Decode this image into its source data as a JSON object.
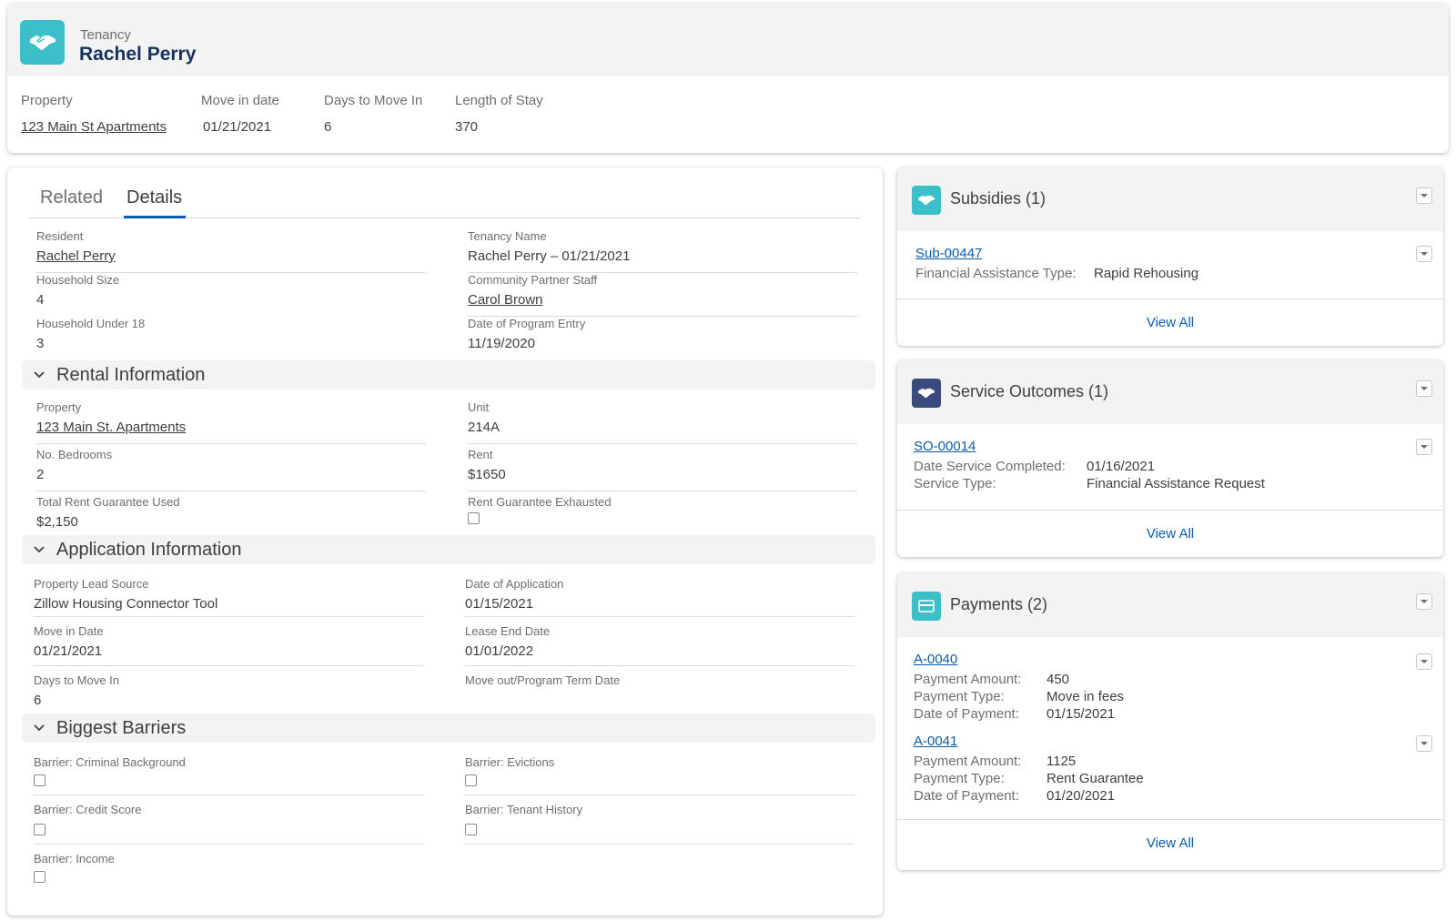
{
  "header": {
    "eyebrow": "Tenancy",
    "title": "Rachel Perry",
    "icon": "handshake-icon",
    "fields": [
      {
        "label": "Property",
        "value": "123 Main St Apartments",
        "is_link": true
      },
      {
        "label": "Move in date",
        "value": "01/21/2021"
      },
      {
        "label": "Days to Move In",
        "value": "6"
      },
      {
        "label": "Length of Stay",
        "value": "370"
      }
    ]
  },
  "tabs": [
    {
      "label": "Related",
      "active": false
    },
    {
      "label": "Details",
      "active": true
    }
  ],
  "details": {
    "resident": {
      "label": "Resident",
      "value": "Rachel Perry"
    },
    "tenancy_name": {
      "label": "Tenancy Name",
      "value": "Rachel Perry – 01/21/2021"
    },
    "household_size": {
      "label": "Household Size",
      "value": "4"
    },
    "partner_staff": {
      "label": "Community Partner Staff",
      "value": "Carol Brown"
    },
    "household_under_18": {
      "label": "Household Under 18",
      "value": "3"
    },
    "program_entry": {
      "label": "Date of Program Entry",
      "value": "11/19/2020"
    }
  },
  "rental": {
    "title": "Rental Information",
    "property": {
      "label": "Property",
      "value": "123 Main St. Apartments"
    },
    "unit": {
      "label": "Unit",
      "value": "214A"
    },
    "bedrooms": {
      "label": "No. Bedrooms",
      "value": "2"
    },
    "rent": {
      "label": "Rent",
      "value": "$1650"
    },
    "guarantee_used": {
      "label": "Total Rent Guarantee Used",
      "value": "$2,150"
    },
    "guarantee_exhausted": {
      "label": "Rent Guarantee Exhausted",
      "checked": false
    }
  },
  "application": {
    "title": "Application Information",
    "lead_source": {
      "label": "Property Lead Source",
      "value": "Zillow Housing Connector Tool"
    },
    "date_of_application": {
      "label": "Date of Application",
      "value": "01/15/2021"
    },
    "move_in_date": {
      "label": "Move in Date",
      "value": "01/21/2021"
    },
    "lease_end": {
      "label": "Lease End Date",
      "value": "01/01/2022"
    },
    "days_to_move_in": {
      "label": "Days to Move In",
      "value": "6"
    },
    "move_out": {
      "label": "Move out/Program Term Date",
      "value": ""
    }
  },
  "barriers": {
    "title": "Biggest Barriers",
    "criminal": {
      "label": "Barrier: Criminal Background",
      "checked": false
    },
    "evictions": {
      "label": "Barrier: Evictions",
      "checked": false
    },
    "credit": {
      "label": "Barrier: Credit Score",
      "checked": false
    },
    "tenant_history": {
      "label": "Barrier: Tenant History",
      "checked": false
    },
    "income": {
      "label": "Barrier: Income",
      "checked": false
    }
  },
  "subsidies": {
    "title": "Subsidies (1)",
    "icon": "handshake-icon",
    "icon_color": "#3bbfc9",
    "record": {
      "id": "Sub-00447",
      "k1": "Financial Assistance Type:",
      "v1": "Rapid Rehousing"
    },
    "view_all": "View All"
  },
  "service_outcomes": {
    "title": "Service Outcomes (1)",
    "icon": "handshake-icon",
    "icon_color": "#3a4a7d",
    "record": {
      "id": "SO-00014",
      "k1": "Date Service Completed:",
      "v1": "01/16/2021",
      "k2": "Service Type:",
      "v2": "Financial Assistance Request"
    },
    "view_all": "View All"
  },
  "payments": {
    "title": "Payments (2)",
    "icon": "payment-card-icon",
    "icon_color": "#3bbfc9",
    "records": [
      {
        "id": "A-0040",
        "amount_label": "Payment Amount:",
        "amount": "450",
        "type_label": "Payment Type:",
        "type": "Move in fees",
        "date_label": "Date of Payment:",
        "date": "01/15/2021"
      },
      {
        "id": "A-0041",
        "amount_label": "Payment Amount:",
        "amount": "1125",
        "type_label": "Payment Type:",
        "type": "Rent Guarantee",
        "date_label": "Date of Payment:",
        "date": "01/20/2021"
      }
    ],
    "view_all": "View All"
  }
}
